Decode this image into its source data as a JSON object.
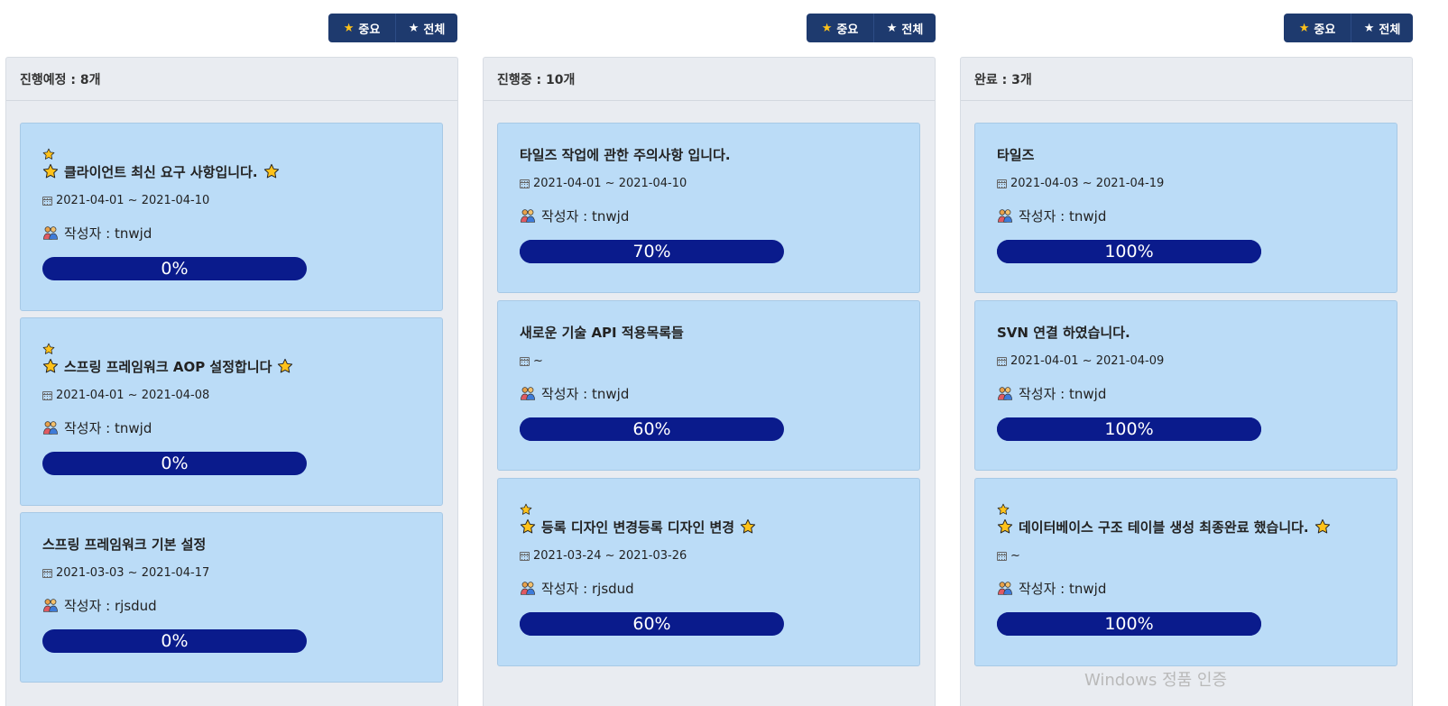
{
  "toolbar": {
    "important_label": "중요",
    "all_label": "전체"
  },
  "columns": [
    {
      "header": "진행예정 : 8개",
      "cards": [
        {
          "starred": true,
          "title": "클라이언트 최신 요구 사항입니다.",
          "date": "2021-04-01 ~ 2021-04-10",
          "author": "작성자 : tnwjd",
          "progress": "0%",
          "progress_value": 0
        },
        {
          "starred": true,
          "title": "스프링 프레임워크 AOP 설정합니다",
          "date": "2021-04-01 ~ 2021-04-08",
          "author": "작성자 : tnwjd",
          "progress": "0%",
          "progress_value": 0
        },
        {
          "starred": false,
          "title": "스프링 프레임워크 기본 설정",
          "date": "2021-03-03 ~ 2021-04-17",
          "author": "작성자 : rjsdud",
          "progress": "0%",
          "progress_value": 0
        }
      ]
    },
    {
      "header": "진행중 : 10개",
      "cards": [
        {
          "starred": false,
          "title": "타일즈 작업에 관한 주의사항 입니다.",
          "date": "2021-04-01 ~ 2021-04-10",
          "author": "작성자 : tnwjd",
          "progress": "70%",
          "progress_value": 70
        },
        {
          "starred": false,
          "title": "새로운 기술 API 적용목록들",
          "date": "~",
          "author": "작성자 : tnwjd",
          "progress": "60%",
          "progress_value": 60
        },
        {
          "starred": true,
          "title": "등록 디자인 변경등록 디자인 변경",
          "date": "2021-03-24 ~ 2021-03-26",
          "author": "작성자 : rjsdud",
          "progress": "60%",
          "progress_value": 60
        }
      ]
    },
    {
      "header": "완료 : 3개",
      "cards": [
        {
          "starred": false,
          "title": "타일즈",
          "date": "2021-04-03 ~ 2021-04-19",
          "author": "작성자 : tnwjd",
          "progress": "100%",
          "progress_value": 100
        },
        {
          "starred": false,
          "title": "SVN 연결 하였습니다.",
          "date": "2021-04-01 ~ 2021-04-09",
          "author": "작성자 : tnwjd",
          "progress": "100%",
          "progress_value": 100
        },
        {
          "starred": true,
          "title": "데이터베이스 구조 테이블 생성 최종완료 했습니다.",
          "date": "~",
          "author": "작성자 : tnwjd",
          "progress": "100%",
          "progress_value": 100
        }
      ]
    }
  ],
  "watermark": "Windows 정품 인증",
  "colors": {
    "button_bg": "#1e3a6e",
    "star_yellow": "#ffc21a",
    "card_bg": "#bbdcf7",
    "panel_bg": "#e9ecf1",
    "progress_bar": "#0a1b8c"
  }
}
